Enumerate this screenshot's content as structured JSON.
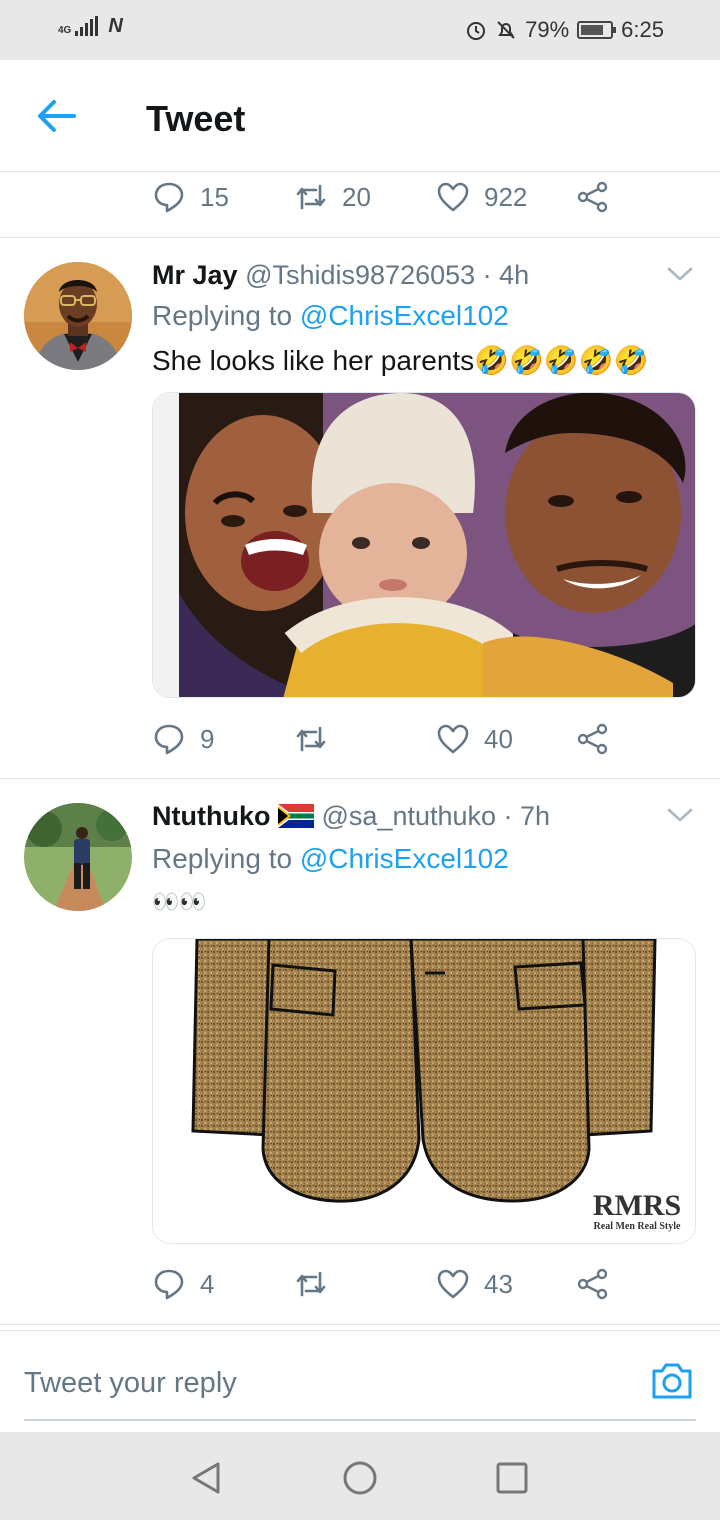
{
  "status_bar": {
    "network": "4G",
    "carrier_logo": "N",
    "icons": [
      "alarm-icon",
      "mute-icon"
    ],
    "battery": "79%",
    "battery_level": 0.79,
    "time": "6:25"
  },
  "header": {
    "title": "Tweet",
    "back_icon": "arrow-left-icon"
  },
  "top_actions": {
    "replies": "15",
    "retweets": "20",
    "likes": "922"
  },
  "tweets": [
    {
      "name": "Mr Jay",
      "handle": "@Tshidis98726053",
      "time": "· 4h",
      "replying_prefix": "Replying to",
      "replying_to": "@ChrisExcel102",
      "text": "She looks like her parents🤣🤣🤣🤣🤣",
      "replies": "9",
      "retweets": "",
      "likes": "40"
    },
    {
      "name": "Ntuthuko",
      "flag": "South Africa flag",
      "handle": "@sa_ntuthuko",
      "time": "· 7h",
      "replying_prefix": "Replying to",
      "replying_to": "@ChrisExcel102",
      "text": "👀👀",
      "media_watermark_title": "RMRS",
      "media_watermark_sub": "Real Men Real Style",
      "replies": "4",
      "retweets": "",
      "likes": "43"
    }
  ],
  "reply_box": {
    "placeholder": "Tweet your reply",
    "icon": "camera-icon"
  },
  "nav": {
    "icons": [
      "back-triangle-icon",
      "home-circle-icon",
      "recents-square-icon"
    ]
  },
  "colors": {
    "accent": "#1da1f2",
    "secondary_text": "#657786",
    "divider": "#e1e8ed"
  }
}
